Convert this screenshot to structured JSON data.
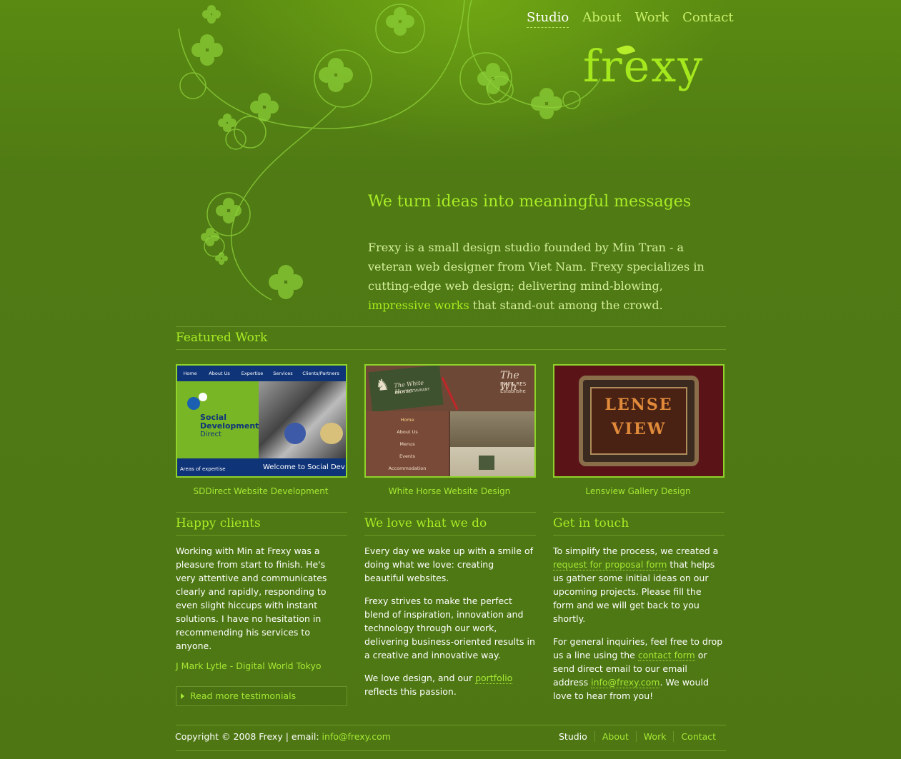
{
  "nav": {
    "items": [
      {
        "label": "Studio",
        "active": true
      },
      {
        "label": "About",
        "active": false
      },
      {
        "label": "Work",
        "active": false
      },
      {
        "label": "Contact",
        "active": false
      }
    ]
  },
  "logo": {
    "text": "frexy"
  },
  "intro": {
    "heading": "We turn ideas into meaningful messages",
    "text_before": "Frexy is a small design studio founded by Min Tran - a veteran web designer from Viet Nam. Frexy specializes in cutting-edge web design; delivering mind-blowing, ",
    "highlight": "impressive works",
    "text_after": " that stand-out among the crowd."
  },
  "featured": {
    "heading": "Featured Work",
    "items": [
      {
        "caption": "SDDirect Website Development",
        "nav": [
          "Home",
          "About Us",
          "Expertise",
          "Services",
          "Clients/Partners"
        ],
        "logo_lines": [
          "Social",
          "Development",
          "Direct"
        ],
        "footer_left": "Areas of expertise",
        "footer_right": "Welcome to Social Dev"
      },
      {
        "caption": "White Horse Website Design",
        "tag_title": "The White Horse",
        "tag_sub": "INN & RESTAURANT",
        "header_right": "The Wh",
        "header_right_sub": "INN & RES",
        "header_right_sub2": "Establishe",
        "menu": [
          "Home",
          "About Us",
          "Menus",
          "Events",
          "Accommodation"
        ]
      },
      {
        "caption": "Lensview Gallery Design",
        "sign_lines": [
          "LENSE",
          "VIEW"
        ]
      }
    ]
  },
  "columns": {
    "happy": {
      "heading": "Happy clients",
      "quote": "Working with Min at Frexy was a pleasure from start to finish. He's very attentive and communicates clearly and rapidly, responding to even slight hiccups with instant solutions. I have no hesitation in recommending his services to anyone.",
      "author": "J Mark Lytle - Digital World Tokyo",
      "read_more": "Read more testimonials"
    },
    "love": {
      "heading": "We love what we do",
      "p1": "Every day we wake up with a smile of doing what we love: creating beautiful websites.",
      "p2": "Frexy strives to make the perfect blend of inspiration, innovation and technology through our work, delivering business-oriented results in a creative and innovative way.",
      "p3_before": "We love design, and our ",
      "p3_link": "portfolio",
      "p3_after": " reflects this passion."
    },
    "touch": {
      "heading": "Get in touch",
      "p1_before": "To simplify the process, we created a ",
      "p1_link": "request for proposal form",
      "p1_after": " that helps us gather some initial ideas on our upcoming projects. Please fill the form and we will get back to you shortly.",
      "p2_before": "For general inquiries, feel free to drop us a line using the ",
      "p2_link": "contact form",
      "p2_mid": " or send direct email to our email address ",
      "p2_email": "info@frexy.com",
      "p2_after": ". We would love to hear from you!"
    }
  },
  "footer": {
    "copyright": "Copyright © 2008 Frexy | email: ",
    "email": "info@frexy.com",
    "nav": [
      "Studio",
      "About",
      "Work",
      "Contact"
    ]
  },
  "colors": {
    "background": "#527a12",
    "accent": "#a9ec26",
    "link": "#a6e834"
  }
}
